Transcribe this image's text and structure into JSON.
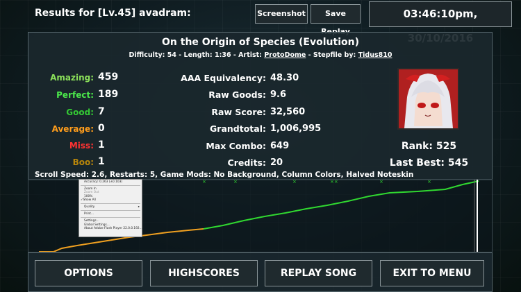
{
  "header": {
    "results_title": "Results for [Lv.45] avadram:",
    "screenshot_label": "Screenshot",
    "save_replay_label": "Save Replay",
    "datetime": "03:46:10pm, 30/10/2016"
  },
  "song": {
    "title": "On the Origin of Species (Evolution)",
    "difficulty_prefix": "Difficulty: 54 - Length: 1:36 - Artist: ",
    "artist": "ProtoDome",
    "stepfile_prefix": " - Stepfile by: ",
    "stepfile_by": "Tidus810"
  },
  "judgements": [
    {
      "label": "Amazing:",
      "value": "459",
      "color": "#8be05a"
    },
    {
      "label": "Perfect:",
      "value": "189",
      "color": "#4be84b"
    },
    {
      "label": "Good:",
      "value": "7",
      "color": "#34c934"
    },
    {
      "label": "Average:",
      "value": "0",
      "color": "#ff9d1c"
    },
    {
      "label": "Miss:",
      "value": "1",
      "color": "#ff3232"
    },
    {
      "label": "Boo:",
      "value": "1",
      "color": "#b8860b"
    }
  ],
  "stats": [
    {
      "label": "AAA Equivalency:",
      "value": "48.30"
    },
    {
      "label": "Raw Goods:",
      "value": "9.6"
    },
    {
      "label": "Raw Score:",
      "value": "32,560"
    },
    {
      "label": "Grandtotal:",
      "value": "1,006,995"
    },
    {
      "label": "Max Combo:",
      "value": "649"
    },
    {
      "label": "Credits:",
      "value": "20"
    }
  ],
  "player": {
    "rank": "Rank: 525",
    "last_best": "Last Best: 545"
  },
  "mods_line": "Scroll Speed: 2.6, Restarts: 5, Game Mods: No Background, Column Colors, Halved Noteskin",
  "context_menu": {
    "items": [
      "Accuracy: 0.263 (±0.103)",
      "Zoom In",
      "Zoom Out",
      "100%",
      "Show All",
      "Quality",
      "Print...",
      "Settings...",
      "Global Settings...",
      "About Adobe Flash Player 22.0.0.192..."
    ]
  },
  "buttons": {
    "options": "OPTIONS",
    "highscores": "HIGHSCORES",
    "replay_song": "REPLAY SONG",
    "exit_to_menu": "EXIT TO MENU"
  },
  "colors": {
    "graph_early": "#f0a020",
    "graph_late": "#30d830",
    "avatar_bg": "#b02020"
  }
}
